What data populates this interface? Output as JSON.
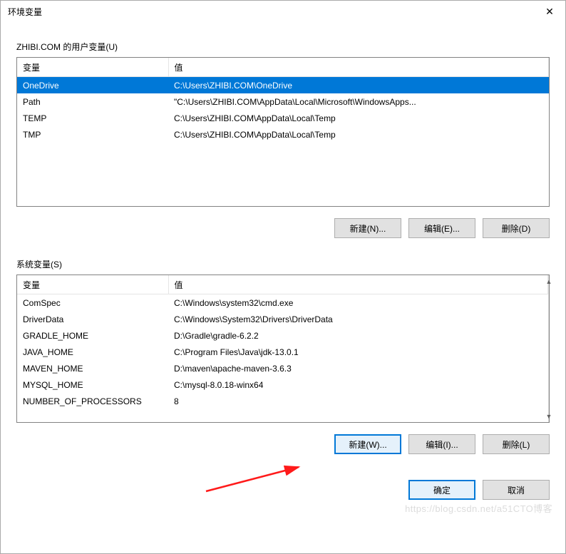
{
  "window": {
    "title": "环境变量",
    "close_glyph": "✕"
  },
  "user_section": {
    "label": "ZHIBI.COM 的用户变量(U)",
    "headers": {
      "name": "变量",
      "value": "值"
    },
    "rows": [
      {
        "name": "OneDrive",
        "value": "C:\\Users\\ZHIBI.COM\\OneDrive",
        "selected": true
      },
      {
        "name": "Path",
        "value": "\"C:\\Users\\ZHIBI.COM\\AppData\\Local\\Microsoft\\WindowsApps...",
        "selected": false
      },
      {
        "name": "TEMP",
        "value": "C:\\Users\\ZHIBI.COM\\AppData\\Local\\Temp",
        "selected": false
      },
      {
        "name": "TMP",
        "value": "C:\\Users\\ZHIBI.COM\\AppData\\Local\\Temp",
        "selected": false
      }
    ],
    "buttons": {
      "new": "新建(N)...",
      "edit": "编辑(E)...",
      "delete": "删除(D)"
    }
  },
  "system_section": {
    "label": "系统变量(S)",
    "headers": {
      "name": "变量",
      "value": "值"
    },
    "rows": [
      {
        "name": "ComSpec",
        "value": "C:\\Windows\\system32\\cmd.exe"
      },
      {
        "name": "DriverData",
        "value": "C:\\Windows\\System32\\Drivers\\DriverData"
      },
      {
        "name": "GRADLE_HOME",
        "value": "D:\\Gradle\\gradle-6.2.2"
      },
      {
        "name": "JAVA_HOME",
        "value": "C:\\Program Files\\Java\\jdk-13.0.1"
      },
      {
        "name": "MAVEN_HOME",
        "value": "D:\\maven\\apache-maven-3.6.3"
      },
      {
        "name": "MYSQL_HOME",
        "value": "C:\\mysql-8.0.18-winx64"
      },
      {
        "name": "NUMBER_OF_PROCESSORS",
        "value": "8"
      }
    ],
    "buttons": {
      "new": "新建(W)...",
      "edit": "编辑(I)...",
      "delete": "删除(L)"
    }
  },
  "dialog_buttons": {
    "ok": "确定",
    "cancel": "取消"
  },
  "watermark": "https://blog.csdn.net/a51CTO博客"
}
